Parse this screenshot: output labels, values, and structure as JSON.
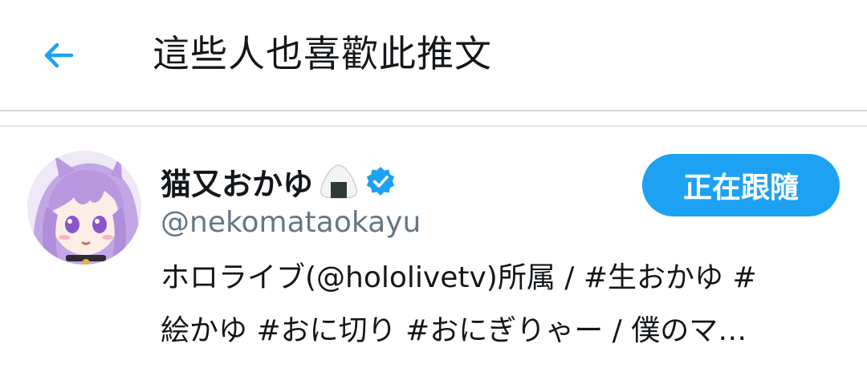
{
  "header": {
    "title": "這些人也喜歡此推文",
    "back_icon": "arrow-left-icon"
  },
  "users": [
    {
      "display_name": "猫又おかゆ",
      "emoji": "onigiri-icon",
      "verified": true,
      "handle": "@nekomataokayu",
      "follow_label": "正在跟隨",
      "bio_lines": [
        "ホロライブ(@hololivetv)所属 / #生おかゆ #",
        "絵かゆ #おに切り #おにぎりゃー / 僕のマ…"
      ]
    }
  ],
  "colors": {
    "accent": "#1da1f2",
    "text_primary": "#14171a",
    "text_secondary": "#657786",
    "divider": "#d6d6d6"
  }
}
